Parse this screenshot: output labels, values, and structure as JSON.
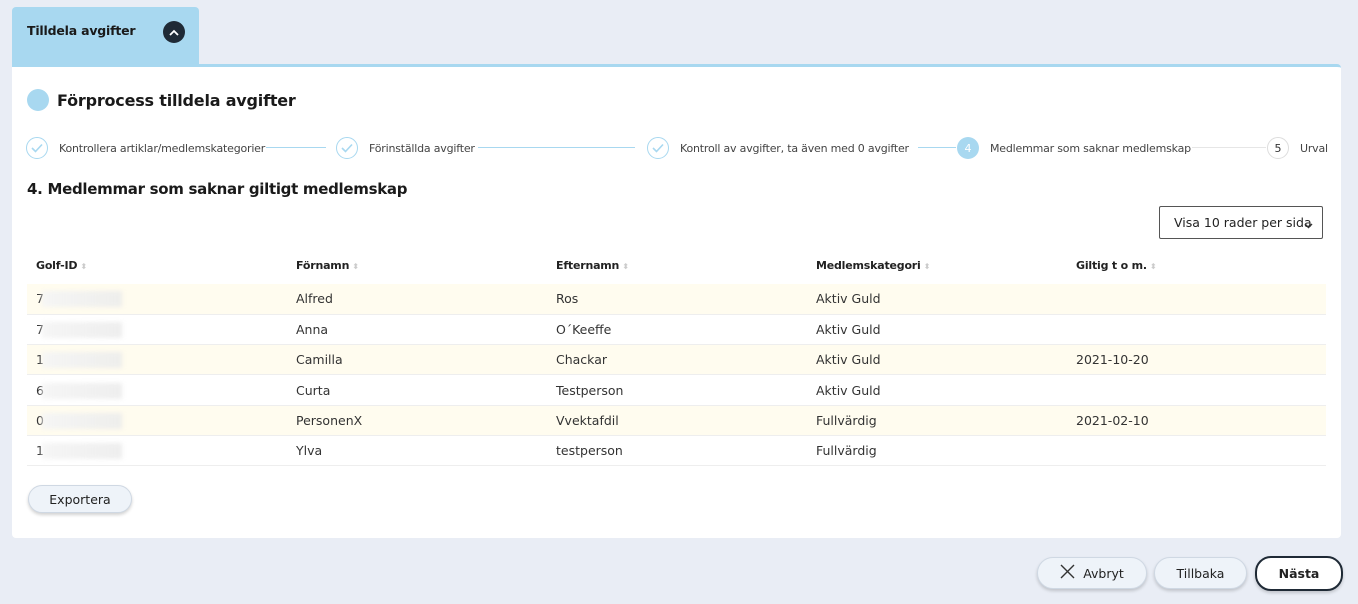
{
  "tab": {
    "title": "Tilldela avgifter"
  },
  "process": {
    "title": "Förprocess tilldela avgifter"
  },
  "steps": [
    {
      "number": "1",
      "label": "Kontrollera artiklar/medlemskategorier",
      "status": "done"
    },
    {
      "number": "2",
      "label": "Förinställda avgifter",
      "status": "done"
    },
    {
      "number": "3",
      "label": "Kontroll av avgifter, ta även med 0 avgifter",
      "status": "done"
    },
    {
      "number": "4",
      "label": "Medlemmar som saknar medlemskap",
      "status": "active"
    },
    {
      "number": "5",
      "label": "Urval",
      "status": "pending"
    }
  ],
  "section": {
    "title": "4. Medlemmar som saknar giltigt medlemskap"
  },
  "rows_select": {
    "value": "Visa 10 rader per sida"
  },
  "table": {
    "columns": [
      "Golf-ID",
      "Förnamn",
      "Efternamn",
      "Medlemskategori",
      "Giltig t o m."
    ],
    "rows": [
      {
        "golf_id": "7",
        "first": "Alfred",
        "last": "Ros",
        "category": "Aktiv Guld",
        "valid": ""
      },
      {
        "golf_id": "7",
        "first": "Anna",
        "last": "O´Keeffe",
        "category": "Aktiv Guld",
        "valid": ""
      },
      {
        "golf_id": "1",
        "first": "Camilla",
        "last": "Chackar",
        "category": "Aktiv Guld",
        "valid": "2021-10-20"
      },
      {
        "golf_id": "6",
        "first": "Curta",
        "last": "Testperson",
        "category": "Aktiv Guld",
        "valid": ""
      },
      {
        "golf_id": "0",
        "first": "PersonenX",
        "last": "Vvektafdil",
        "category": "Fullvärdig",
        "valid": "2021-02-10"
      },
      {
        "golf_id": "1",
        "first": "Ylva",
        "last": "testperson",
        "category": "Fullvärdig",
        "valid": ""
      }
    ]
  },
  "buttons": {
    "export": "Exportera",
    "cancel": "Avbryt",
    "back": "Tillbaka",
    "next": "Nästa"
  },
  "colors": {
    "accent": "#a8d8f0",
    "dark": "#1f2a36",
    "row_highlight": "#fffcef"
  }
}
